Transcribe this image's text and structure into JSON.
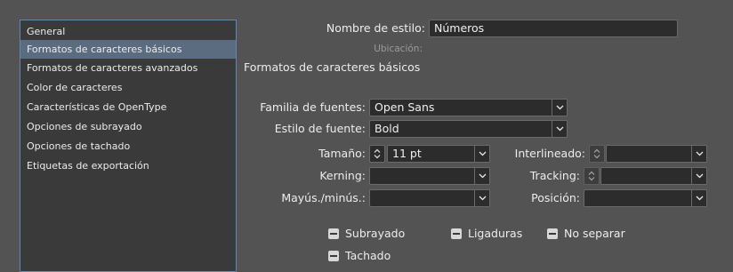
{
  "sidebar": {
    "items": [
      {
        "label": "General"
      },
      {
        "label": "Formatos de caracteres básicos"
      },
      {
        "label": "Formatos de caracteres avanzados"
      },
      {
        "label": "Color de caracteres"
      },
      {
        "label": "Características de OpenType"
      },
      {
        "label": "Opciones de subrayado"
      },
      {
        "label": "Opciones de tachado"
      },
      {
        "label": "Etiquetas de exportación"
      }
    ],
    "selected_index": 1
  },
  "header": {
    "style_name_label": "Nombre de estilo:",
    "style_name_value": "Números",
    "location_label": "Ubicación:",
    "section_title": "Formatos de caracteres básicos"
  },
  "form": {
    "font_family_label": "Familia de fuentes:",
    "font_family_value": "Open Sans",
    "font_style_label": "Estilo de fuente:",
    "font_style_value": "Bold",
    "size_label": "Tamaño:",
    "size_value": "11 pt",
    "leading_label": "Interlineado:",
    "leading_value": "",
    "kerning_label": "Kerning:",
    "kerning_value": "",
    "tracking_label": "Tracking:",
    "tracking_value": "",
    "case_label": "Mayús./minús.:",
    "case_value": "",
    "position_label": "Posición:",
    "position_value": ""
  },
  "checkboxes": {
    "underline": "Subrayado",
    "ligatures": "Ligaduras",
    "no_break": "No separar",
    "strikethrough": "Tachado"
  },
  "icons": {
    "chevron": "chevron-down-icon",
    "stepper": "stepper-updown-icon"
  },
  "colors": {
    "background": "#535353",
    "selection": "#5b6b80",
    "focus_border": "#5f89b5"
  }
}
